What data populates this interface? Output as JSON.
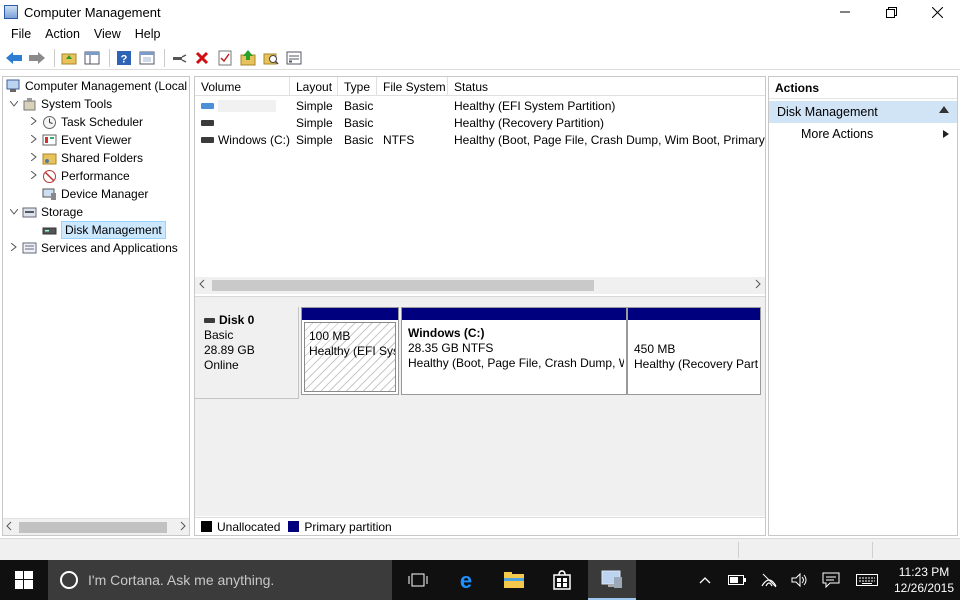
{
  "window": {
    "title": "Computer Management",
    "minimize": "—",
    "restore": "❐",
    "close": "✕"
  },
  "menu": [
    "File",
    "Action",
    "View",
    "Help"
  ],
  "tree": {
    "items": [
      {
        "label": "Computer Management (Local",
        "level": 0,
        "expander": ""
      },
      {
        "label": "System Tools",
        "level": 1,
        "expander": "⌄"
      },
      {
        "label": "Task Scheduler",
        "level": 2,
        "expander": "›"
      },
      {
        "label": "Event Viewer",
        "level": 2,
        "expander": "›"
      },
      {
        "label": "Shared Folders",
        "level": 2,
        "expander": "›"
      },
      {
        "label": "Performance",
        "level": 2,
        "expander": "›"
      },
      {
        "label": "Device Manager",
        "level": 2,
        "expander": ""
      },
      {
        "label": "Storage",
        "level": 1,
        "expander": "⌄"
      },
      {
        "label": "Disk Management",
        "level": 2,
        "expander": "",
        "selected": true
      },
      {
        "label": "Services and Applications",
        "level": 1,
        "expander": "›"
      }
    ]
  },
  "volumes": {
    "columns": [
      "Volume",
      "Layout",
      "Type",
      "File System",
      "Status"
    ],
    "rows": [
      {
        "volume": "",
        "layout": "Simple",
        "type": "Basic",
        "fs": "",
        "status": "Healthy (EFI System Partition)"
      },
      {
        "volume": "",
        "layout": "Simple",
        "type": "Basic",
        "fs": "",
        "status": "Healthy (Recovery Partition)"
      },
      {
        "volume": "Windows (C:)",
        "layout": "Simple",
        "type": "Basic",
        "fs": "NTFS",
        "status": "Healthy (Boot, Page File, Crash Dump, Wim Boot, Primary P"
      }
    ]
  },
  "disk": {
    "name": "Disk 0",
    "type": "Basic",
    "size": "28.89 GB",
    "state": "Online",
    "partitions": [
      {
        "title": "",
        "size": "100 MB",
        "status": "Healthy (EFI Syst"
      },
      {
        "title": "Windows  (C:)",
        "size": "28.35 GB NTFS",
        "status": "Healthy (Boot, Page File, Crash Dump, W"
      },
      {
        "title": "",
        "size": "450 MB",
        "status": "Healthy (Recovery Part"
      }
    ]
  },
  "legend": {
    "unallocated": "Unallocated",
    "primary": "Primary partition",
    "unallocated_color": "#000000",
    "primary_color": "#00007f"
  },
  "actions": {
    "title": "Actions",
    "group": "Disk Management",
    "more": "More Actions"
  },
  "taskbar": {
    "cortana": "I'm Cortana. Ask me anything.",
    "time": "11:23 PM",
    "date": "12/26/2015"
  }
}
